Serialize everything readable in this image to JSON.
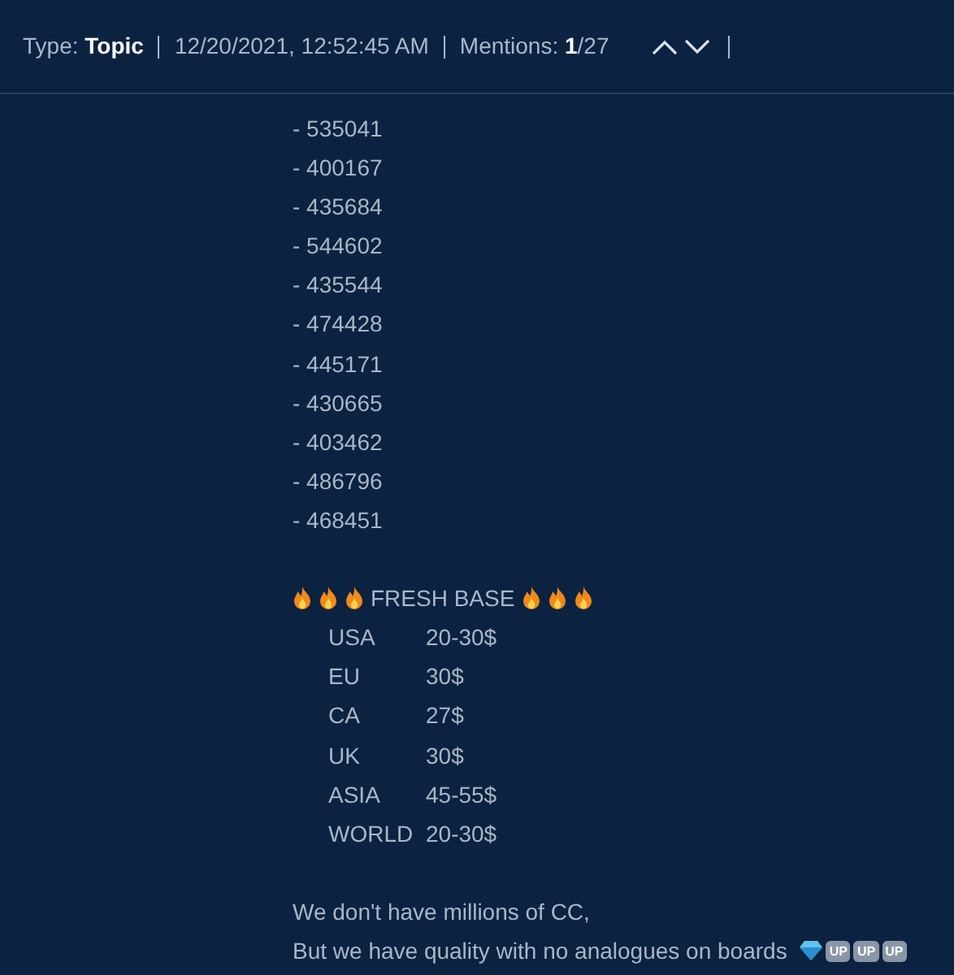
{
  "header": {
    "type": "Type: **Topic**",
    "date": "12/20/2021, 12:52:45 AM",
    "mentions": "Mentions: **1**/27"
  },
  "post": {
    "bins": [
      "- 535041",
      "- 400167",
      "- 435684",
      "- 544602",
      "- 435544",
      "- 474428",
      "- 445171",
      "- 430665",
      "- 403462",
      "- 486796",
      "- 468451"
    ],
    "offer_title": "FRESH BASE",
    "prices": [
      {
        "region": "USA",
        "price": "20-30$"
      },
      {
        "region": "EU",
        "price": "30$"
      },
      {
        "region": "CA",
        "price": "27$"
      },
      {
        "region": "UK",
        "price": "30$"
      },
      {
        "region": "ASIA",
        "price": "45-55$"
      },
      {
        "region": "WORLD",
        "price": "20-30$"
      }
    ],
    "closing": [
      "We don't have millions of CC,",
      "But we have quality with no analogues on boards"
    ],
    "keycaps": [
      "UP",
      "UP",
      "UP"
    ]
  }
}
